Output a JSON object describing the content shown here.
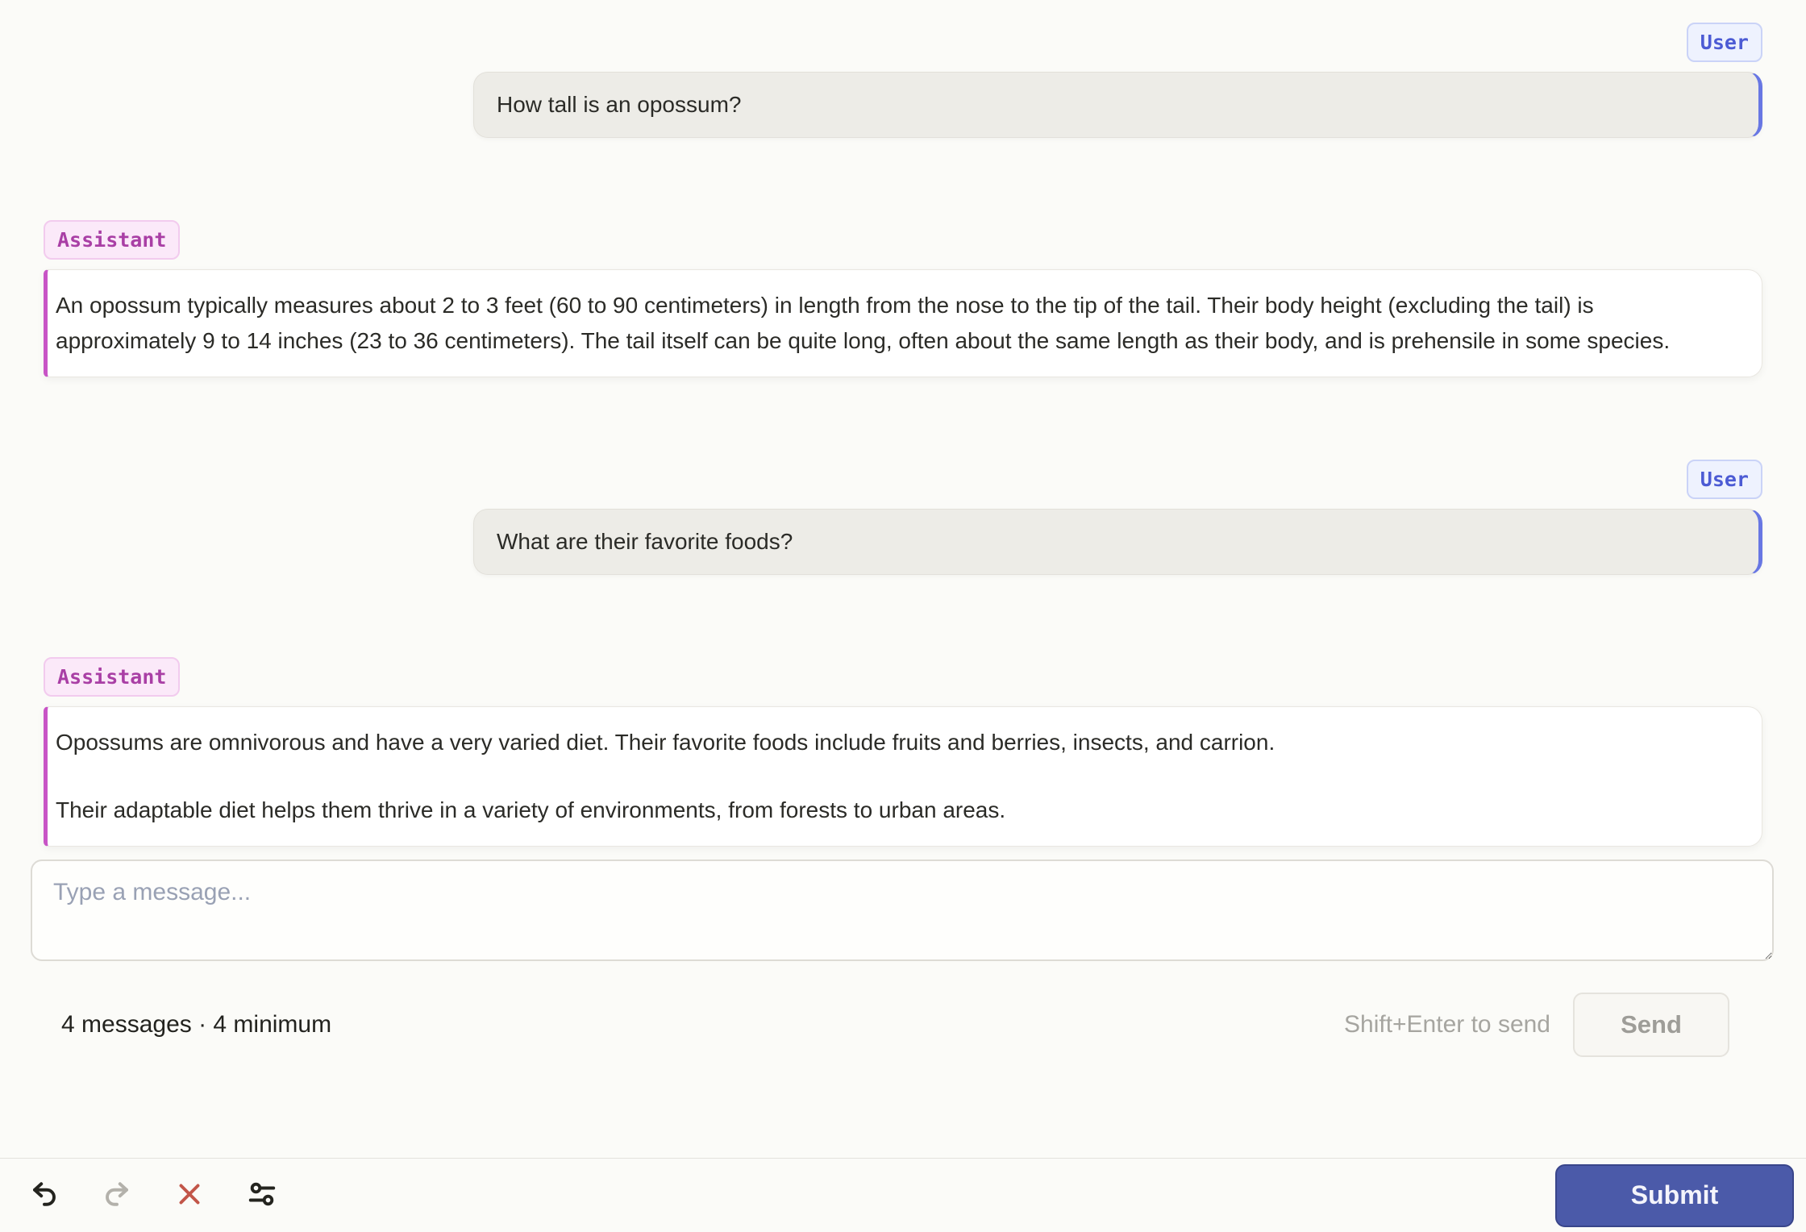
{
  "colors": {
    "page_background": "#FBFBF8",
    "user_accent": "#6877E3",
    "user_badge_text": "#4C5BD4",
    "user_bubble_bg": "#EDECE7",
    "assistant_accent": "#C854C6",
    "assistant_badge_text": "#A93FA5",
    "assistant_card_bg": "#FFFFFF",
    "danger_icon": "#C25649",
    "submit_bg": "#4B5AA9"
  },
  "messages": [
    {
      "role": "User",
      "text": "How tall is an opossum?"
    },
    {
      "role": "Assistant",
      "paragraphs": [
        "An opossum typically measures about 2 to 3 feet (60 to 90 centimeters) in length from the nose to the tip of the tail. Their body height (excluding the tail) is approximately 9 to 14 inches (23 to 36 centimeters). The tail itself can be quite long, often about the same length as their body, and is prehensile in some species."
      ]
    },
    {
      "role": "User",
      "text": "What are their favorite foods?"
    },
    {
      "role": "Assistant",
      "paragraphs": [
        "Opossums are omnivorous and have a very varied diet. Their favorite foods include fruits and berries, insects, and carrion.",
        "Their adaptable diet helps them thrive in a variety of environments, from forests to urban areas."
      ]
    }
  ],
  "composer": {
    "placeholder": "Type a message...",
    "status": "4 messages · 4 minimum",
    "hint": "Shift+Enter to send",
    "send_label": "Send"
  },
  "toolbar": {
    "icons": [
      "undo",
      "redo",
      "discard",
      "settings"
    ],
    "submit_label": "Submit"
  }
}
